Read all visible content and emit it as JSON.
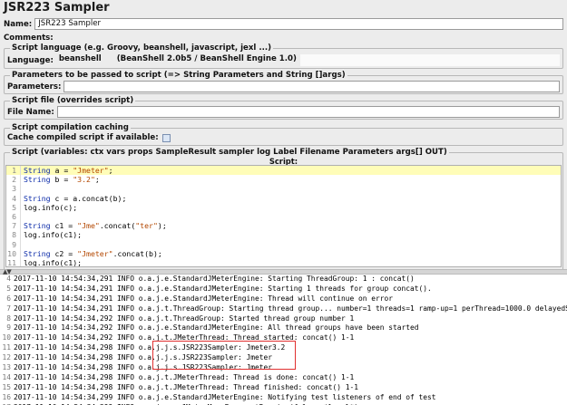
{
  "title": "JSR223 Sampler",
  "name": {
    "label": "Name:",
    "value": "JSR223 Sampler"
  },
  "comments": {
    "label": "Comments:"
  },
  "language_group": {
    "title": "Script language (e.g. Groovy, beanshell, javascript, jexl ...)",
    "label": "Language:",
    "value": "beanshell",
    "engine": "(BeanShell 2.0b5 / BeanShell Engine 1.0)"
  },
  "parameters_group": {
    "title": "Parameters to be passed to script (=> String Parameters and String []args)",
    "label": "Parameters:"
  },
  "file_group": {
    "title": "Script file (overrides script)",
    "label": "File Name:"
  },
  "caching_group": {
    "title": "Script compilation caching",
    "label": "Cache compiled script if available:"
  },
  "script_group": {
    "title": "Script (variables: ctx vars props SampleResult sampler log Label Filename Parameters args[] OUT)",
    "script_label": "Script:"
  },
  "script_lines": [
    {
      "n": "1",
      "text": "String a = \"Jmeter\";"
    },
    {
      "n": "2",
      "text": "String b = \"3.2\";"
    },
    {
      "n": "3",
      "text": ""
    },
    {
      "n": "4",
      "text": "String c = a.concat(b);"
    },
    {
      "n": "5",
      "text": "log.info(c);"
    },
    {
      "n": "6",
      "text": ""
    },
    {
      "n": "7",
      "text": "String c1 = \"Jme\".concat(\"ter\");"
    },
    {
      "n": "8",
      "text": "log.info(c1);"
    },
    {
      "n": "9",
      "text": ""
    },
    {
      "n": "10",
      "text": "String c2 = \"Jmeter\".concat(b);"
    },
    {
      "n": "11",
      "text": "log.info(c1);"
    }
  ],
  "log_lines": [
    {
      "n": "4",
      "text": "2017-11-10 14:54:34,291 INFO o.a.j.e.StandardJMeterEngine: Starting ThreadGroup: 1 : concat()"
    },
    {
      "n": "5",
      "text": "2017-11-10 14:54:34,291 INFO o.a.j.e.StandardJMeterEngine: Starting 1 threads for group concat()."
    },
    {
      "n": "6",
      "text": "2017-11-10 14:54:34,291 INFO o.a.j.e.StandardJMeterEngine: Thread will continue on error"
    },
    {
      "n": "7",
      "text": "2017-11-10 14:54:34,291 INFO o.a.j.t.ThreadGroup: Starting thread group... number=1 threads=1 ramp-up=1 perThread=1000.0 delayedStart=false"
    },
    {
      "n": "8",
      "text": "2017-11-10 14:54:34,292 INFO o.a.j.t.ThreadGroup: Started thread group number 1"
    },
    {
      "n": "9",
      "text": "2017-11-10 14:54:34,292 INFO o.a.j.e.StandardJMeterEngine: All thread groups have been started"
    },
    {
      "n": "10",
      "text": "2017-11-10 14:54:34,292 INFO o.a.j.t.JMeterThread: Thread started: concat() 1-1"
    },
    {
      "n": "11",
      "text": "2017-11-10 14:54:34,298 INFO o.a.j.j.s.JSR223Sampler: Jmeter3.2"
    },
    {
      "n": "12",
      "text": "2017-11-10 14:54:34,298 INFO o.a.j.j.s.JSR223Sampler: Jmeter"
    },
    {
      "n": "13",
      "text": "2017-11-10 14:54:34,298 INFO o.a.j.j.s.JSR223Sampler: Jmeter"
    },
    {
      "n": "14",
      "text": "2017-11-10 14:54:34,298 INFO o.a.j.t.JMeterThread: Thread is done: concat() 1-1"
    },
    {
      "n": "15",
      "text": "2017-11-10 14:54:34,298 INFO o.a.j.t.JMeterThread: Thread finished: concat() 1-1"
    },
    {
      "n": "16",
      "text": "2017-11-10 14:54:34,299 INFO o.a.j.e.StandardJMeterEngine: Notifying test listeners of end of test"
    },
    {
      "n": "17",
      "text": "2017-11-10 14:54:34,299 INFO o.a.j.g.u.JMeterMenuBar: setRunning(false, *local*)"
    }
  ],
  "colors": {
    "highlight_box": "#e03030",
    "current_line": "#fffdb8",
    "keyword": "#0a2aa8",
    "string": "#b34700"
  }
}
